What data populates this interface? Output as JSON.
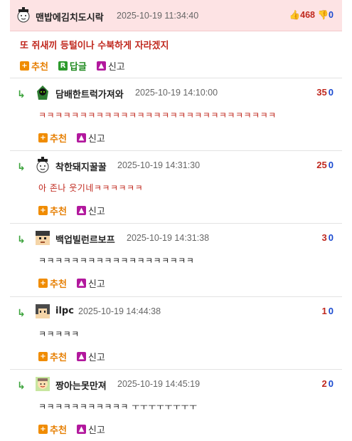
{
  "main": {
    "nick": "맨밥에김치도시락",
    "date": "2025-10-19 11:34:40",
    "up_count": "468",
    "down_count": "0",
    "text": "또 쥐새끼 등털이나 수북하게 자라겠지",
    "actions": {
      "recommend": "추천",
      "reply": "답글",
      "report": "신고"
    }
  },
  "replies": [
    {
      "nick": "담배한트럭가져와",
      "date": "2025-10-19 14:10:00",
      "up": "35",
      "down": "0",
      "text": "ㅋㅋㅋㅋㅋㅋㅋㅋㅋㅋㅋㅋㅋㅋㅋㅋㅋㅋㅋㅋㅋㅋㅋㅋㅋㅋㅋㅋㅋ",
      "recommend": "추천",
      "report": "신고"
    },
    {
      "nick": "착한돼지꿀꿀",
      "date": "2025-10-19 14:31:30",
      "up": "25",
      "down": "0",
      "text": "아 존나 웃기네ㅋㅋㅋㅋㅋㅋ",
      "recommend": "추천",
      "report": "신고"
    },
    {
      "nick": "백업빌런르보프",
      "date": "2025-10-19 14:31:38",
      "up": "3",
      "down": "0",
      "text": "ㅋㅋㅋㅋㅋㅋㅋㅋㅋㅋㅋㅋㅋㅋㅋㅋㅋㅋㅋ",
      "recommend": "추천",
      "report": "신고"
    },
    {
      "nick": "ilpc",
      "date": "2025-10-19 14:44:38",
      "up": "1",
      "down": "0",
      "text": "ㅋㅋㅋㅋㅋ",
      "recommend": "추천",
      "report": "신고"
    },
    {
      "nick": "짱아는못만져",
      "date": "2025-10-19 14:45:19",
      "up": "2",
      "down": "0",
      "text": "ㅋㅋㅋㅋㅋㅋㅋㅋㅋㅋㅋ ㅜㅜㅜㅜㅜㅜㅜㅜ",
      "recommend": "추천",
      "report": "신고"
    }
  ],
  "icons": {
    "reply_arrow": "reply-arrow-icon",
    "recommend": "plus-icon",
    "reply": "r-badge-icon",
    "report": "siren-icon"
  },
  "colors": {
    "header_bg": "#fde3e4",
    "accent_red": "#c0281e",
    "accent_blue": "#1a4ad0",
    "recommend_orange": "#e67e00",
    "reply_green": "#1f8a1f"
  }
}
